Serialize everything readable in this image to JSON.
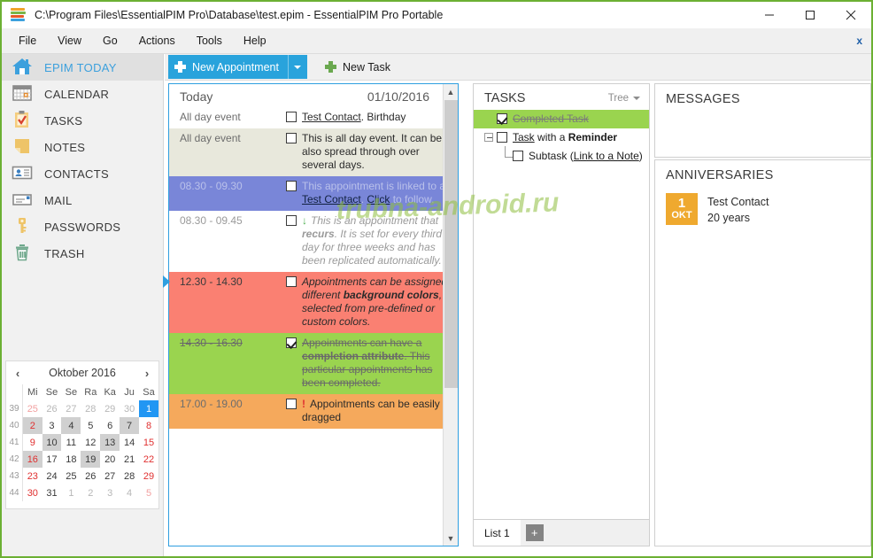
{
  "window": {
    "title": "C:\\Program Files\\EssentialPIM Pro\\Database\\test.epim - EssentialPIM Pro Portable",
    "minimize_label": "–",
    "maximize_label": "☐",
    "close_label": "✕"
  },
  "menu": {
    "items": [
      "File",
      "View",
      "Go",
      "Actions",
      "Tools",
      "Help"
    ],
    "close_label": "x"
  },
  "sidebar": {
    "items": [
      {
        "label": "EPIM TODAY",
        "icon": "home-icon",
        "active": true
      },
      {
        "label": "CALENDAR",
        "icon": "calendar-icon",
        "active": false
      },
      {
        "label": "TASKS",
        "icon": "clipboard-check-icon",
        "active": false
      },
      {
        "label": "NOTES",
        "icon": "note-icon",
        "active": false
      },
      {
        "label": "CONTACTS",
        "icon": "contact-card-icon",
        "active": false
      },
      {
        "label": "MAIL",
        "icon": "envelope-icon",
        "active": false
      },
      {
        "label": "PASSWORDS",
        "icon": "key-icon",
        "active": false
      },
      {
        "label": "TRASH",
        "icon": "trash-icon",
        "active": false
      }
    ]
  },
  "minicalendar": {
    "prev_label": "‹",
    "next_label": "›",
    "month_year": "Oktober 2016",
    "weekday_headers": [
      "Mi",
      "Se",
      "Se",
      "Ra",
      "Ka",
      "Ju",
      "Sa"
    ],
    "week_numbers": [
      "39",
      "40",
      "41",
      "42",
      "43",
      "44"
    ],
    "weeks": [
      [
        {
          "d": "25",
          "style": "dimred"
        },
        {
          "d": "26",
          "style": "dim"
        },
        {
          "d": "27",
          "style": "dim"
        },
        {
          "d": "28",
          "style": "dim"
        },
        {
          "d": "29",
          "style": "dim"
        },
        {
          "d": "30",
          "style": "dim"
        },
        {
          "d": "1",
          "style": "sel"
        }
      ],
      [
        {
          "d": "2",
          "style": "red shade"
        },
        {
          "d": "3",
          "style": ""
        },
        {
          "d": "4",
          "style": "shade"
        },
        {
          "d": "5",
          "style": ""
        },
        {
          "d": "6",
          "style": ""
        },
        {
          "d": "7",
          "style": "shade"
        },
        {
          "d": "8",
          "style": "red"
        }
      ],
      [
        {
          "d": "9",
          "style": "red"
        },
        {
          "d": "10",
          "style": "shade"
        },
        {
          "d": "11",
          "style": ""
        },
        {
          "d": "12",
          "style": ""
        },
        {
          "d": "13",
          "style": "shade"
        },
        {
          "d": "14",
          "style": ""
        },
        {
          "d": "15",
          "style": "red"
        }
      ],
      [
        {
          "d": "16",
          "style": "red shade"
        },
        {
          "d": "17",
          "style": ""
        },
        {
          "d": "18",
          "style": ""
        },
        {
          "d": "19",
          "style": "shade"
        },
        {
          "d": "20",
          "style": ""
        },
        {
          "d": "21",
          "style": ""
        },
        {
          "d": "22",
          "style": "red"
        }
      ],
      [
        {
          "d": "23",
          "style": "red"
        },
        {
          "d": "24",
          "style": ""
        },
        {
          "d": "25",
          "style": ""
        },
        {
          "d": "26",
          "style": ""
        },
        {
          "d": "27",
          "style": ""
        },
        {
          "d": "28",
          "style": ""
        },
        {
          "d": "29",
          "style": "red"
        }
      ],
      [
        {
          "d": "30",
          "style": "red"
        },
        {
          "d": "31",
          "style": ""
        },
        {
          "d": "1",
          "style": "dim"
        },
        {
          "d": "2",
          "style": "dim"
        },
        {
          "d": "3",
          "style": "dim"
        },
        {
          "d": "4",
          "style": "dim"
        },
        {
          "d": "5",
          "style": "dimred"
        }
      ]
    ]
  },
  "toolbar": {
    "new_appointment": "New Appointment",
    "new_task": "New Task"
  },
  "today": {
    "title": "Today",
    "date": "01/10/2016",
    "appointments": [
      {
        "time": "All day event",
        "text_parts": [
          {
            "t": "Test Contact",
            "link": true
          },
          {
            "t": ". Birthday",
            "link": false
          }
        ],
        "checked": false,
        "row_class": "",
        "icon": ""
      },
      {
        "time": "All day event",
        "text_parts": [
          {
            "t": "This is all day event. It can be also spread through over several days.",
            "link": false
          }
        ],
        "checked": false,
        "row_class": "row-allday2",
        "icon": ""
      },
      {
        "time": "08.30 - 09.30",
        "text_parts": [
          {
            "t": "This appointment is linked to a ",
            "link": false
          },
          {
            "t": "Test Contact",
            "link": true
          },
          {
            "t": ". ",
            "link": false
          },
          {
            "t": "Click",
            "link": true
          },
          {
            "t": " to follow.",
            "link": false
          }
        ],
        "checked": false,
        "row_class": "row-linked",
        "icon": ""
      },
      {
        "time": "08.30 - 09.45",
        "text_parts": [
          {
            "t": "This is an appointment that ",
            "link": false
          },
          {
            "t": "recurs",
            "link": false,
            "bold": true
          },
          {
            "t": ". It is set for every third day for three weeks and has been replicated automatically.",
            "link": false
          }
        ],
        "checked": false,
        "row_class": "row-recur",
        "icon": "recurrence-arrow-icon"
      },
      {
        "time": "12.30 - 14.30",
        "text_parts": [
          {
            "t": "Appointments can be assigned different ",
            "link": false
          },
          {
            "t": "background colors",
            "link": false,
            "bold": true
          },
          {
            "t": ", selected from pre-defined or custom colors.",
            "link": false
          }
        ],
        "checked": false,
        "row_class": "row-color",
        "icon": ""
      },
      {
        "time": "14.30 - 16.30",
        "text_parts": [
          {
            "t": "Appointments can have a ",
            "link": false
          },
          {
            "t": "completion attribute",
            "link": false,
            "bold": true
          },
          {
            "t": ". This particular appointments has been completed.",
            "link": false
          }
        ],
        "checked": true,
        "row_class": "row-done",
        "icon": ""
      },
      {
        "time": "17.00 - 19.00",
        "text_parts": [
          {
            "t": "Appointments can be easily dragged",
            "link": false
          }
        ],
        "checked": false,
        "row_class": "row-drag",
        "icon": "priority-high-icon"
      }
    ]
  },
  "tasks": {
    "title": "TASKS",
    "view_mode": "Tree",
    "items": [
      {
        "text_parts": [
          {
            "t": "Completed Task",
            "link": false
          }
        ],
        "checked": true,
        "done": true,
        "level": 0,
        "expander": false
      },
      {
        "text_parts": [
          {
            "t": "Task",
            "link": true
          },
          {
            "t": " with a ",
            "link": false
          },
          {
            "t": "Reminder",
            "link": false,
            "bold": true
          }
        ],
        "checked": false,
        "done": false,
        "level": 0,
        "expander": true
      },
      {
        "text_parts": [
          {
            "t": "Subtask (",
            "link": false
          },
          {
            "t": "Link to a Note",
            "link": true
          },
          {
            "t": ")",
            "link": false
          }
        ],
        "checked": false,
        "done": false,
        "level": 1,
        "expander": false
      }
    ],
    "tab_label": "List 1",
    "add_label": "+"
  },
  "messages": {
    "title": "MESSAGES"
  },
  "anniversaries": {
    "title": "ANNIVERSARIES",
    "entries": [
      {
        "day": "1",
        "month": "OKT",
        "name": "Test Contact",
        "detail": "20 years"
      }
    ]
  },
  "watermark": {
    "text": "trubna-android.ru"
  },
  "colors": {
    "accent_blue": "#29a3dc",
    "window_border_green": "#6cb033",
    "row_done_green": "#9ad44f",
    "row_color_salmon": "#fa8072",
    "row_drag_orange": "#f5a95c",
    "row_linked_blue": "#7986d8",
    "anniversary_orange": "#efa92f",
    "selected_day_blue": "#2196f3"
  }
}
